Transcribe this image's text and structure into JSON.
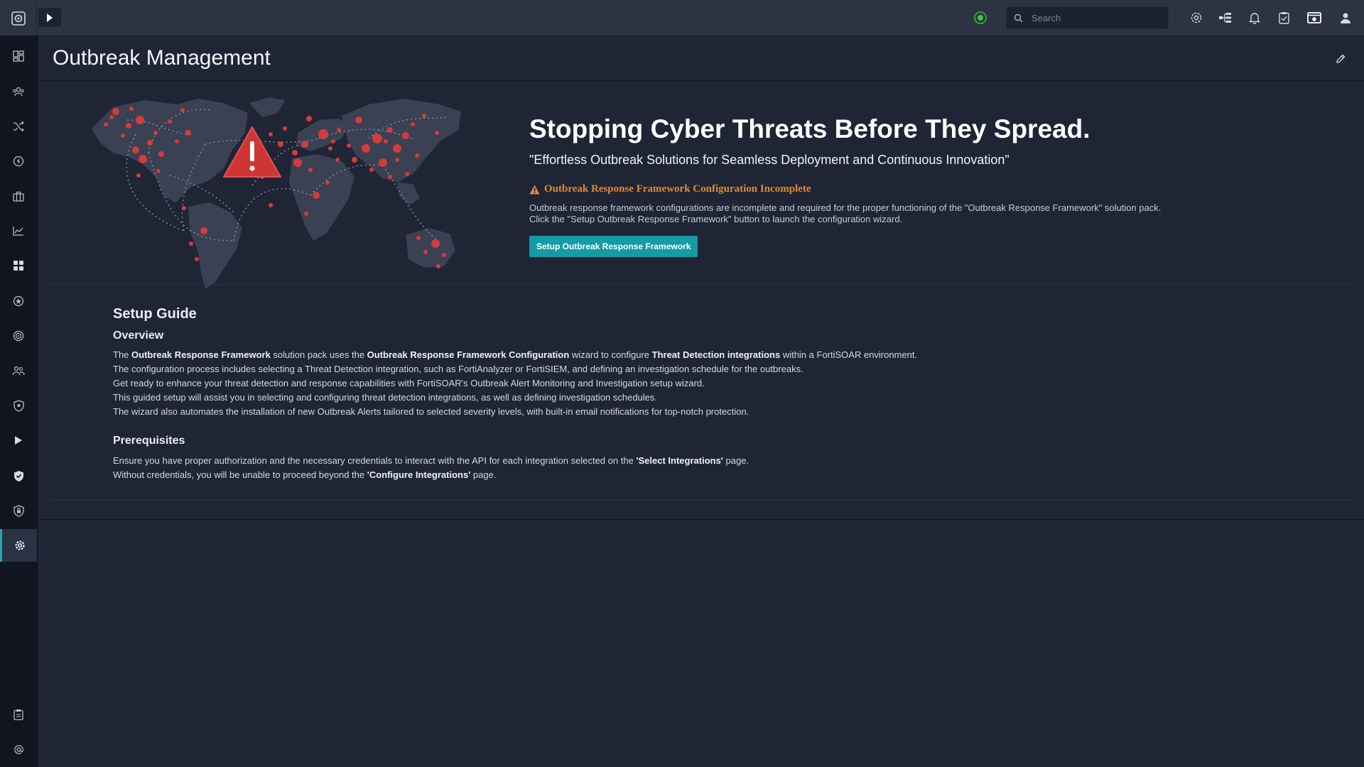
{
  "topbar": {
    "search_placeholder": "Search"
  },
  "colors": {
    "accent": "#159ba3",
    "warning": "#e4892a",
    "status_ok": "#3cc54a"
  },
  "page": {
    "title": "Outbreak Management"
  },
  "hero": {
    "headline": "Stopping Cyber Threats Before They Spread.",
    "subheadline": "\"Effortless Outbreak Solutions for Seamless Deployment and Continuous Innovation\"",
    "warning_title": "Outbreak Response Framework Configuration Incomplete",
    "warning_line1": "Outbreak response framework configurations are incomplete and required for the proper functioning of the \"Outbreak Response Framework\" solution pack.",
    "warning_line2": "Click the \"Setup Outbreak Response Framework\" button to launch the configuration wizard.",
    "setup_button": "Setup Outbreak Response Framework"
  },
  "guide": {
    "title": "Setup Guide",
    "overview_heading": "Overview",
    "overview": {
      "l1_a": "The ",
      "l1_b": "Outbreak Response Framework",
      "l1_c": " solution pack uses the ",
      "l1_d": "Outbreak Response Framework Configuration",
      "l1_e": " wizard to configure ",
      "l1_f": "Threat Detection integrations",
      "l1_g": " within a FortiSOAR environment.",
      "l2": "The configuration process includes selecting a Threat Detection integration, such as FortiAnalyzer or FortiSIEM, and defining an investigation schedule for the outbreaks.",
      "l3": "Get ready to enhance your threat detection and response capabilities with FortiSOAR's Outbreak Alert Monitoring and Investigation setup wizard.",
      "l4": "This guided setup will assist you in selecting and configuring threat detection integrations, as well as defining investigation schedules.",
      "l5": "The wizard also automates the installation of new Outbreak Alerts tailored to selected severity levels, with built-in email notifications for top-notch protection."
    },
    "prereq_heading": "Prerequisites",
    "prereq": {
      "l1_a": "Ensure you have proper authorization and the necessary credentials to interact with the API for each integration selected on the ",
      "l1_b": "'Select Integrations'",
      "l1_c": " page.",
      "l2_a": "Without credentials, you will be unable to proceed beyond the ",
      "l2_b": "'Configure Integrations'",
      "l2_c": " page."
    }
  },
  "sidebar_icons": [
    "dashboard-icon",
    "users-group-icon",
    "shuffle-icon",
    "bolt-icon",
    "briefcase-icon",
    "chart-icon",
    "grid-icon",
    "shield-star-icon",
    "target-icon",
    "people-icon",
    "shield-icon",
    "play-icon",
    "shield-check-icon",
    "shield-lock-icon",
    "gear-icon"
  ]
}
